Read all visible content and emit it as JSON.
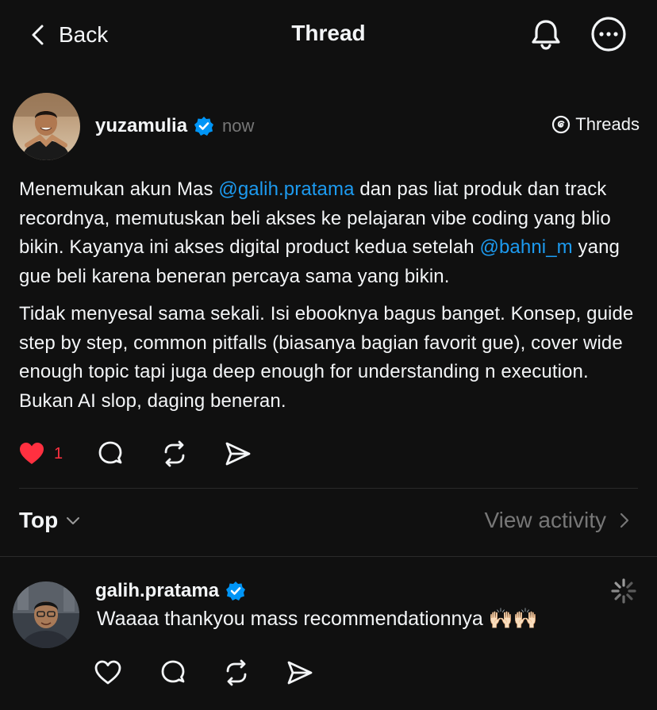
{
  "header": {
    "back_label": "Back",
    "title": "Thread"
  },
  "post": {
    "author": "yuzamulia",
    "time": "now",
    "threads_label": "Threads",
    "paragraph1": [
      {
        "text": "Menemukan akun Mas ",
        "mention": false
      },
      {
        "text": "@galih.pratama",
        "mention": true
      },
      {
        "text": " dan pas liat produk dan track recordnya, memutuskan beli akses ke pelajaran vibe coding yang blio bikin. Kayanya ini akses digital product kedua setelah ",
        "mention": false
      },
      {
        "text": "@bahni_m",
        "mention": true
      },
      {
        "text": " yang gue beli karena beneran percaya sama yang bikin.",
        "mention": false
      }
    ],
    "paragraph2": "Tidak menyesal sama sekali. Isi ebooknya bagus banget. Konsep, guide step by step, common pitfalls (biasanya bagian favorit gue), cover wide enough topic tapi juga deep enough for understanding n execution. Bukan AI slop, daging beneran.",
    "like_count": "1",
    "liked": true
  },
  "sort": {
    "label": "Top",
    "view_activity_label": "View activity"
  },
  "reply": {
    "author": "galih.pratama",
    "text": "Waaaa thankyou mass recommendationnya 🙌🏻🙌🏻"
  },
  "colors": {
    "background": "#101010",
    "text": "#f3f5f7",
    "muted": "#777777",
    "mention": "#1d9bf0",
    "like": "#ff3040",
    "verified": "#0095f6"
  },
  "icons": {
    "back": "chevron-left-icon",
    "notifications": "bell-icon",
    "more": "ellipsis-circle-icon",
    "verified": "verified-badge-icon",
    "threads": "threads-logo-icon",
    "like": "heart-icon",
    "comment": "comment-bubble-icon",
    "repost": "repost-icon",
    "share": "send-icon",
    "sort": "chevron-down-icon",
    "view_activity": "chevron-right-icon",
    "loading": "loading-spinner-icon"
  }
}
